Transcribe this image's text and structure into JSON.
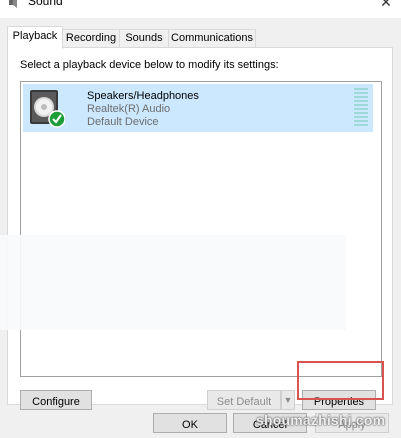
{
  "window": {
    "title": "Sound",
    "close_glyph": "✕"
  },
  "tabs": [
    {
      "label": "Playback",
      "active": true
    },
    {
      "label": "Recording",
      "active": false
    },
    {
      "label": "Sounds",
      "active": false
    },
    {
      "label": "Communications",
      "active": false
    }
  ],
  "playback": {
    "instruction": "Select a playback device below to modify its settings:",
    "devices": [
      {
        "name": "Speakers/Headphones",
        "driver": "Realtek(R) Audio",
        "status": "Default Device",
        "icon": "speaker-icon",
        "badge": "green-check-icon",
        "selected": true
      }
    ],
    "buttons": {
      "configure": "Configure",
      "set_default": "Set Default",
      "properties": "Properties"
    }
  },
  "dialog_buttons": {
    "ok": "OK",
    "cancel": "Cancel",
    "apply": "Apply"
  },
  "watermark": "shoumazhishi.com",
  "colors": {
    "selection": "#cce8ff",
    "highlight": "#d9534f",
    "check_green": "#1e9e3a"
  }
}
